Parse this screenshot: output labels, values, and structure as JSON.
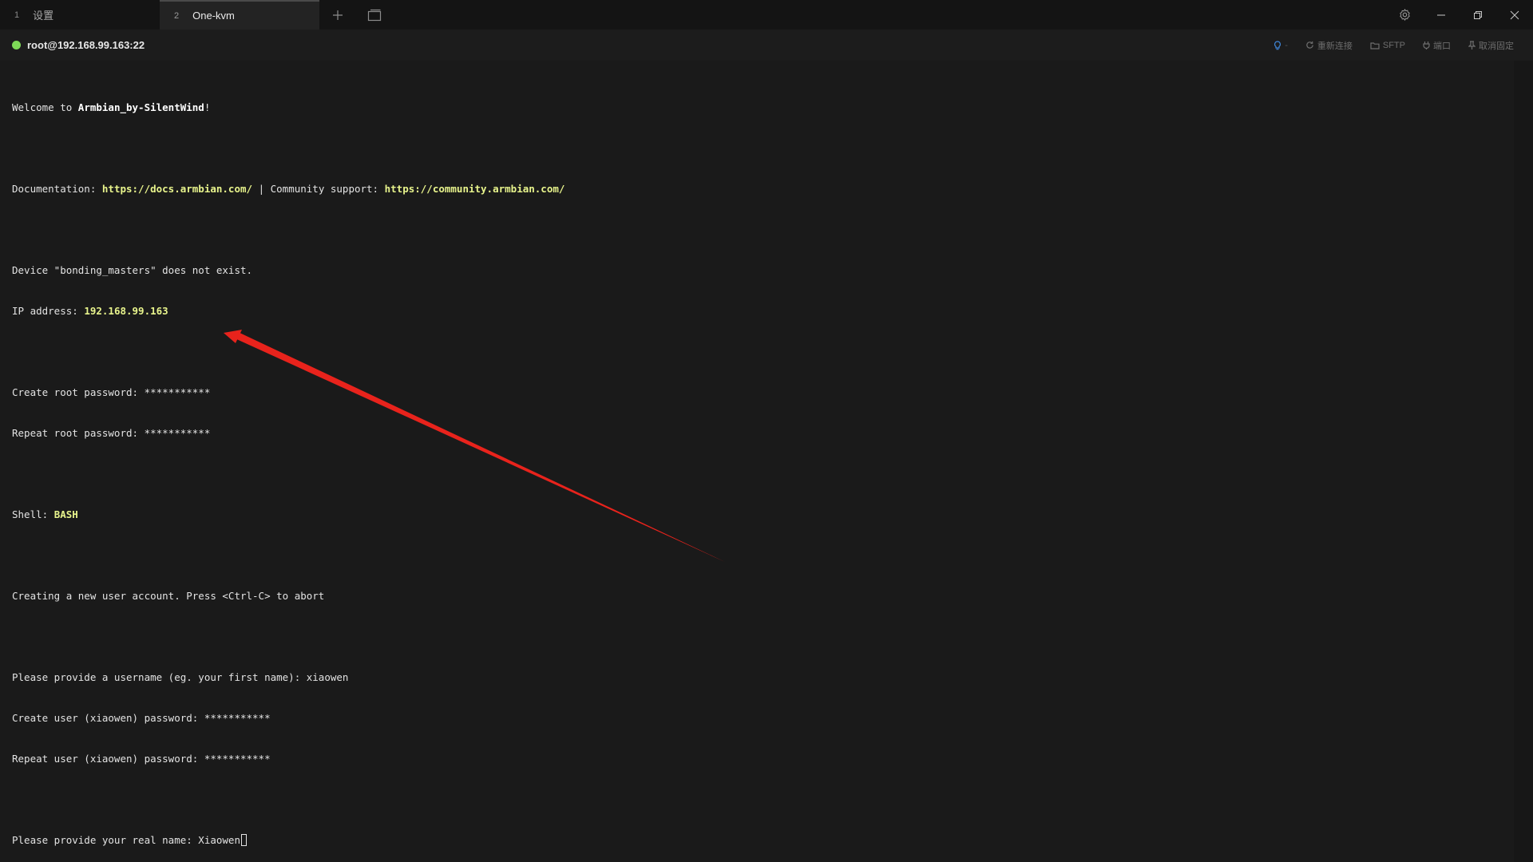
{
  "tabs": [
    {
      "index": "1",
      "label": "设置"
    },
    {
      "index": "2",
      "label": "One-kvm"
    }
  ],
  "session": {
    "host": "root@192.168.99.163:22",
    "status_color": "#7ed957",
    "bulb_dash": "-",
    "reconnect_label": "重新连接",
    "sftp_label": "SFTP",
    "port_label": "端口",
    "unpin_label": "取消固定"
  },
  "terminal": {
    "welcome_prefix": "Welcome to ",
    "welcome_name": "Armbian_by-SilentWind",
    "welcome_suffix": "!",
    "doc_prefix": "Documentation: ",
    "doc_url": "https://docs.armbian.com/",
    "doc_sep": " | Community support: ",
    "community_url": "https://community.armbian.com/",
    "device_line": "Device \"bonding_masters\" does not exist.",
    "ip_prefix": "IP address: ",
    "ip_value": "192.168.99.163",
    "root_pw_create": "Create root password: ***********",
    "root_pw_repeat": "Repeat root password: ***********",
    "shell_prefix": "Shell: ",
    "shell_value": "BASH",
    "create_user": "Creating a new user account. Press <Ctrl-C> to abort",
    "username_prompt": "Please provide a username (eg. your first name): xiaowen",
    "user_pw_create": "Create user (xiaowen) password: ***********",
    "user_pw_repeat": "Repeat user (xiaowen) password: ***********",
    "realname_prompt": "Please provide your real name: ",
    "realname_value": "Xiaowen"
  },
  "colors": {
    "background": "#1a1a1a",
    "highlight": "#e8f48c",
    "annotation_arrow": "#e8231c",
    "accent_blue": "#3f86d9"
  }
}
